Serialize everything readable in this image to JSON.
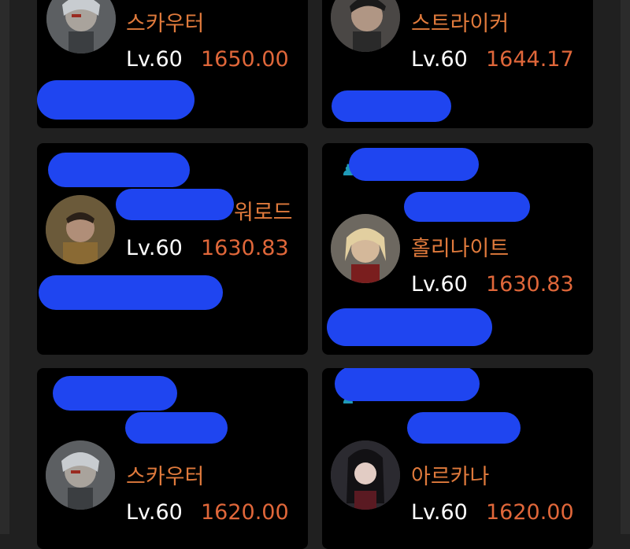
{
  "cards": [
    {
      "class_name": "스카우터",
      "level": "Lv.60",
      "score": "1650.00",
      "avatar_icon": "scout-portrait"
    },
    {
      "class_name": "스트라이커",
      "level": "Lv.60",
      "score": "1644.17",
      "avatar_icon": "striker-portrait"
    },
    {
      "class_name": "워로드",
      "level": "Lv.60",
      "score": "1630.83",
      "avatar_icon": "warlord-portrait"
    },
    {
      "class_name": "홀리나이트",
      "level": "Lv.60",
      "score": "1630.83",
      "avatar_icon": "holyknight-portrait"
    },
    {
      "class_name": "스카우터",
      "level": "Lv.60",
      "score": "1620.00",
      "avatar_icon": "scout-portrait"
    },
    {
      "class_name": "아르카나",
      "level": "Lv.60",
      "score": "1620.00",
      "avatar_icon": "arcana-portrait"
    }
  ],
  "colors": {
    "class_text": "#e07a3c",
    "score_text": "#e0673a",
    "redaction": "#1f45f0",
    "card_bg": "#000000",
    "page_bg": "#202020"
  }
}
